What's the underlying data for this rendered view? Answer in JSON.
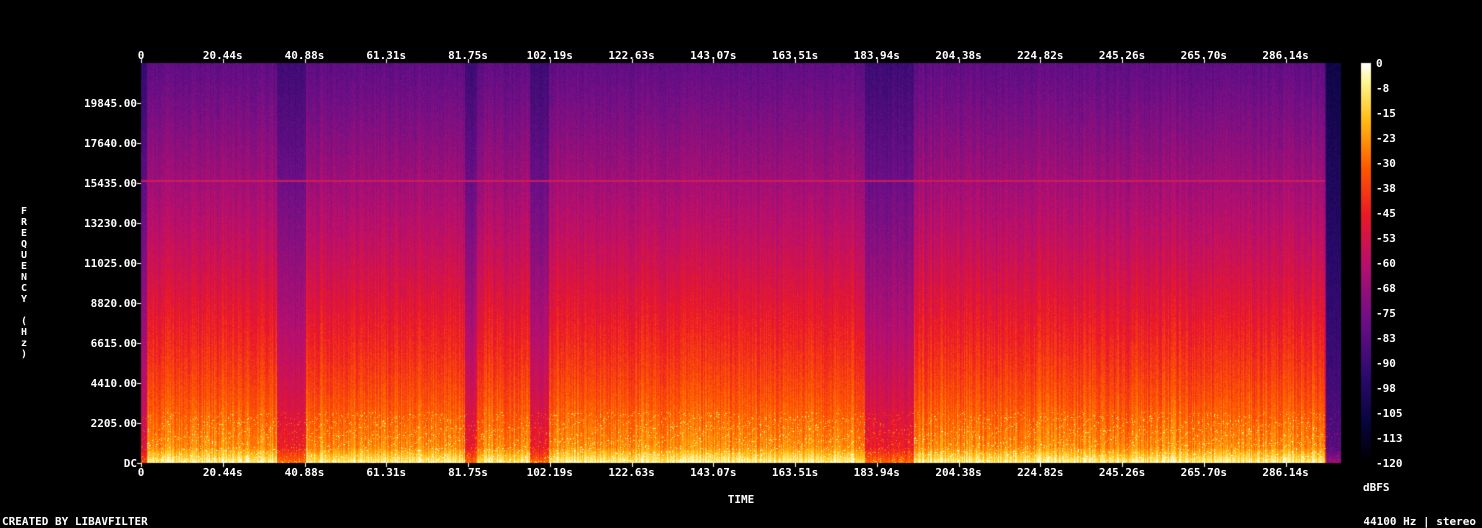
{
  "chart_data": {
    "type": "heatmap",
    "title": "",
    "xlabel": "TIME",
    "ylabel": "FREQUENCY (Hz)",
    "x_ticks": [
      "0",
      "20.44s",
      "40.88s",
      "61.31s",
      "81.75s",
      "102.19s",
      "122.63s",
      "143.07s",
      "163.51s",
      "183.94s",
      "204.38s",
      "224.82s",
      "245.26s",
      "265.70s",
      "286.14s"
    ],
    "x_tick_values_s": [
      0,
      20.44,
      40.88,
      61.31,
      81.75,
      102.19,
      122.63,
      143.07,
      163.51,
      183.94,
      204.38,
      224.82,
      245.26,
      265.7,
      286.14
    ],
    "y_ticks": [
      "DC",
      "2205.00",
      "4410.00",
      "6615.00",
      "8820.00",
      "11025.00",
      "13230.00",
      "15435.00",
      "17640.00",
      "19845.00"
    ],
    "y_tick_values_hz": [
      0,
      2205,
      4410,
      6615,
      8820,
      11025,
      13230,
      15435,
      17640,
      19845
    ],
    "xlim": [
      0,
      300
    ],
    "ylim": [
      0,
      22050
    ],
    "colorbar": {
      "label": "dBFS",
      "ticks": [
        "0",
        "-8",
        "-15",
        "-23",
        "-30",
        "-38",
        "-45",
        "-53",
        "-60",
        "-68",
        "-75",
        "-83",
        "-90",
        "-98",
        "-105",
        "-113",
        "-120"
      ],
      "range": [
        -120,
        0
      ]
    },
    "quiet_segments_s": [
      [
        34,
        41
      ],
      [
        81,
        84
      ],
      [
        97,
        102
      ],
      [
        181,
        193
      ],
      [
        296,
        300
      ]
    ],
    "tonal_line_hz": 15625
  },
  "footer": {
    "left": "CREATED BY LIBAVFILTER",
    "right": "44100 Hz | stereo"
  },
  "colors": {
    "background": "#000000",
    "text": "#ffffff"
  }
}
